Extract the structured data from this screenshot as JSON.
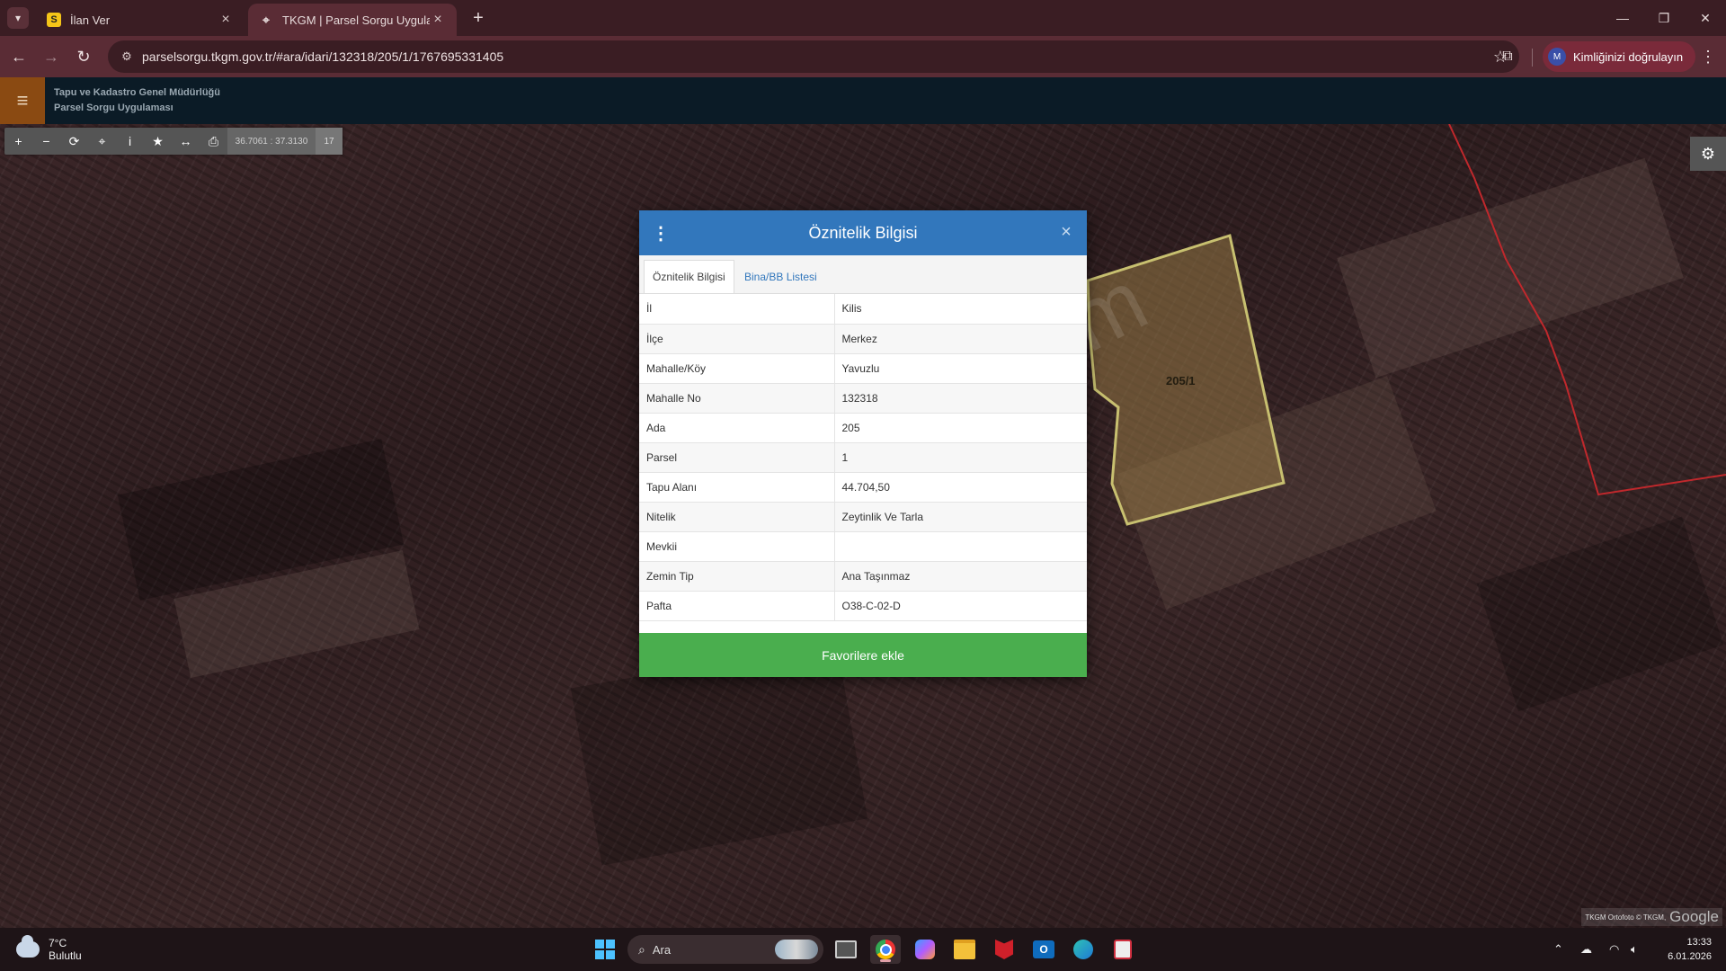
{
  "browser": {
    "tabs": [
      {
        "title": "İlan Ver",
        "favicon": "S"
      },
      {
        "title": "TKGM | Parsel Sorgu Uygulaması",
        "favicon": "location-pin"
      }
    ],
    "url": "parselsorgu.tkgm.gov.tr/#ara/idari/132318/205/1/1767695331405",
    "profile_label": "Kimliğinizi doğrulayın",
    "profile_initial": "M"
  },
  "app": {
    "org_line1": "Tapu ve Kadastro Genel Müdürlüğü",
    "org_line2": "Parsel Sorgu Uygulaması"
  },
  "map": {
    "coordinates": "36.7061 : 37.3130",
    "zoom": "17",
    "parcel_label": "205/1",
    "attribution_text": "TKGM Ortofoto © TKGM,",
    "attribution_brand": "Google",
    "watermark": "emlakjet.com"
  },
  "modal": {
    "title": "Öznitelik Bilgisi",
    "tabs": [
      "Öznitelik Bilgisi",
      "Bina/BB Listesi"
    ],
    "rows": [
      {
        "key": "İl",
        "value": "Kilis"
      },
      {
        "key": "İlçe",
        "value": "Merkez"
      },
      {
        "key": "Mahalle/Köy",
        "value": "Yavuzlu"
      },
      {
        "key": "Mahalle No",
        "value": "132318"
      },
      {
        "key": "Ada",
        "value": "205"
      },
      {
        "key": "Parsel",
        "value": "1"
      },
      {
        "key": "Tapu Alanı",
        "value": "44.704,50"
      },
      {
        "key": "Nitelik",
        "value": "Zeytinlik Ve Tarla"
      },
      {
        "key": "Mevkii",
        "value": ""
      },
      {
        "key": "Zemin Tip",
        "value": "Ana Taşınmaz"
      },
      {
        "key": "Pafta",
        "value": "O38-C-02-D"
      }
    ],
    "button": "Favorilere ekle"
  },
  "taskbar": {
    "temperature": "7°C",
    "weather": "Bulutlu",
    "search_placeholder": "Ara",
    "time": "13:33",
    "date": "6.01.2026"
  },
  "colors": {
    "modal_header": "#3277bc",
    "favorite_button": "#4aae4e",
    "parcel_outline": "#c8c070",
    "boundary_line": "#c0282c"
  }
}
